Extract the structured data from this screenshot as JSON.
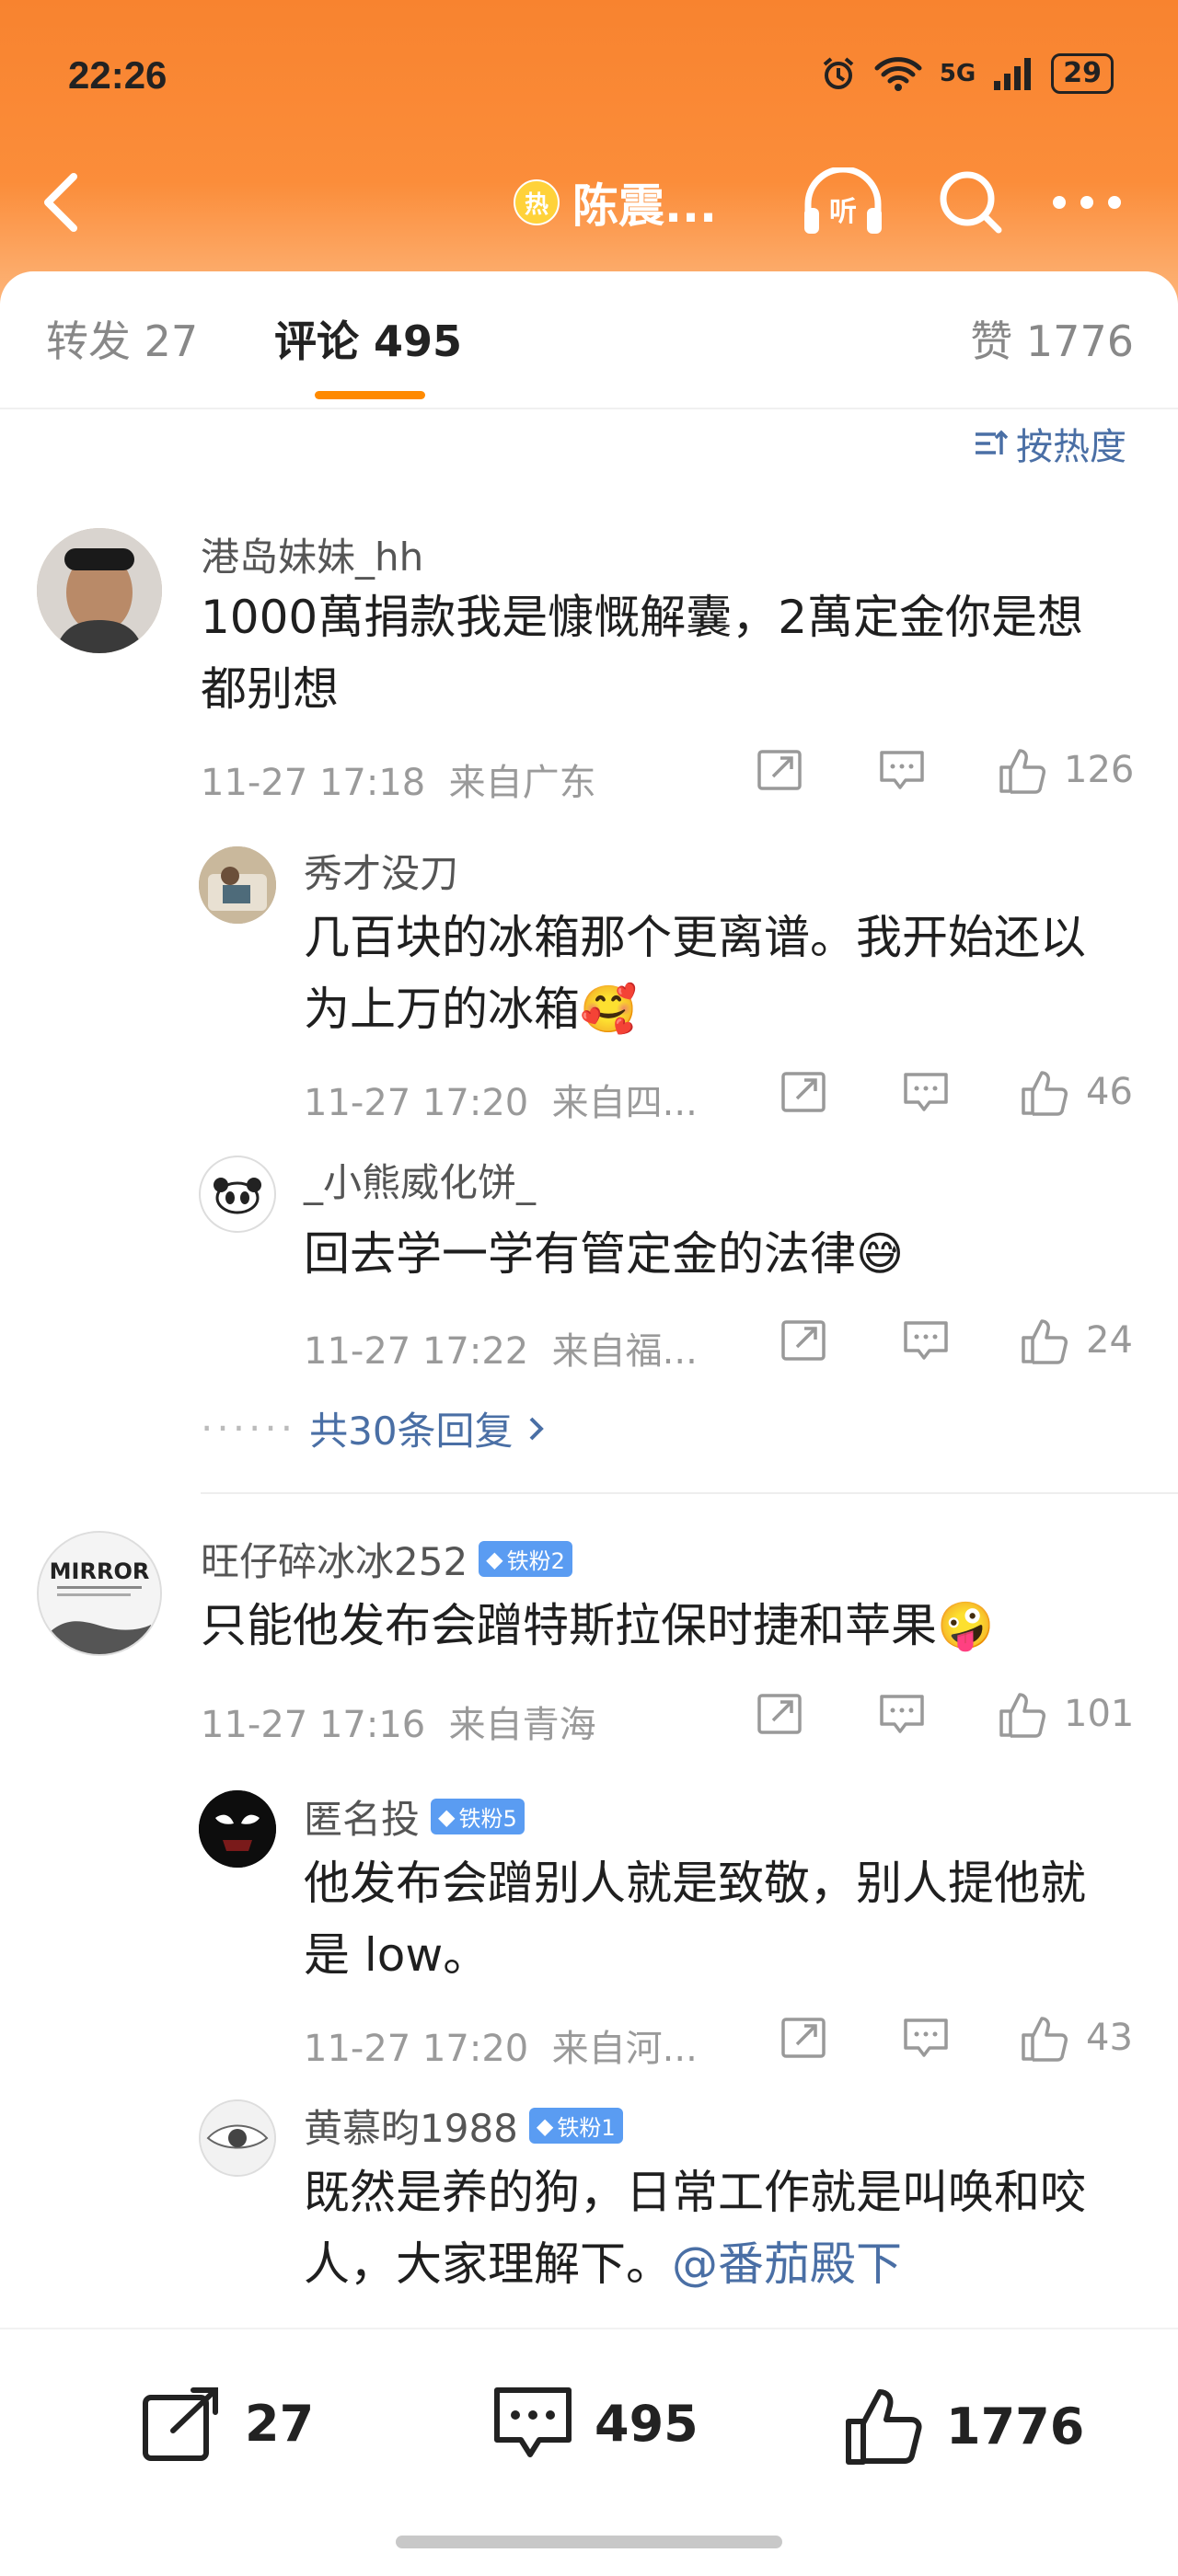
{
  "status": {
    "time": "22:26",
    "battery": "29",
    "net": "5G"
  },
  "nav": {
    "hot_badge": "热",
    "title": "陈震..."
  },
  "tabs": {
    "forward": "转发 27",
    "comments": "评论 495",
    "likes": "赞 1776"
  },
  "sort_label": "按热度",
  "comments": [
    {
      "user": "港岛妹妹_hh",
      "text1": "1000萬捐款我是慷慨解囊，2萬定金你是想",
      "text2": "都别想",
      "time": "11-27 17:18",
      "location": "来自广东",
      "likes": "126",
      "replies": [
        {
          "user": "秀才没刀",
          "text1": "几百块的冰箱那个更离谱。我开始还以",
          "text2": "为上万的冰箱",
          "emoji": "🥰",
          "time": "11-27 17:20",
          "location": "来自四...",
          "likes": "46"
        },
        {
          "user": "_小熊威化饼_",
          "text1": "回去学一学有管定金的法律",
          "emoji": "😅",
          "time": "11-27 17:22",
          "location": "来自福...",
          "likes": "24"
        }
      ],
      "more": "共30条回复"
    },
    {
      "user": "旺仔碎冰冰252",
      "badge": "铁粉2",
      "text1": "只能他发布会蹭特斯拉保时捷和苹果",
      "emoji": "🤪",
      "time": "11-27 17:16",
      "location": "来自青海",
      "likes": "101",
      "avatar_text": "MIRROR",
      "replies": [
        {
          "user": "匿名投",
          "badge": "铁粉5",
          "text1": "他发布会蹭别人就是致敬，别人提他就",
          "text2": "是 low。",
          "time": "11-27 17:20",
          "location": "来自河...",
          "likes": "43"
        },
        {
          "user": "黄慕昀1988",
          "badge": "铁粉1",
          "text1": "既然是养的狗，日常工作就是叫唤和咬",
          "text2": "人，大家理解下。",
          "mention": "@番茄殿下"
        }
      ]
    }
  ],
  "bottom": {
    "forward": "27",
    "comments": "495",
    "likes": "1776"
  },
  "colors": {
    "header": "#f8832f",
    "link": "#4a6fa5",
    "accent": "#ff8a00"
  }
}
